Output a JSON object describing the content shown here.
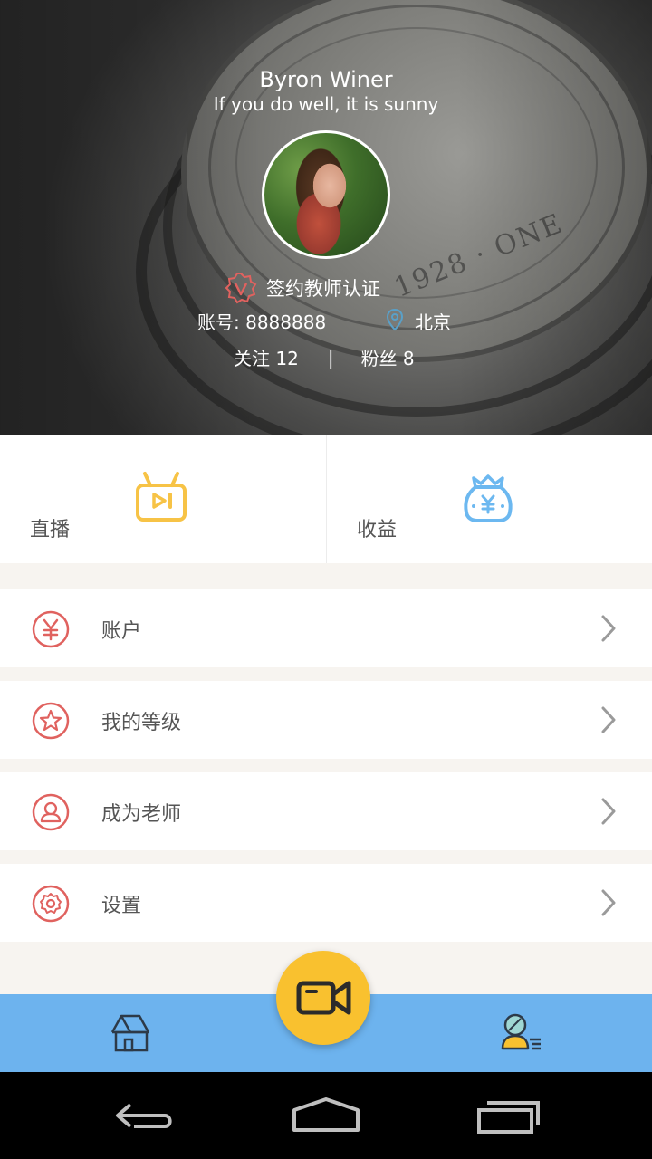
{
  "profile": {
    "name": "Byron Winer",
    "motto": "If you do well, it is sunny",
    "certification": "签约教师认证",
    "account": "账号: 8888888",
    "location": "北京",
    "following": "关注 12",
    "separator": "|",
    "followers": "粉丝 8"
  },
  "tiles": [
    {
      "label": "直播",
      "icon": "tv-play-icon",
      "color": "#f7c346"
    },
    {
      "label": "收益",
      "icon": "money-bag-icon",
      "color": "#6cb8f0"
    }
  ],
  "menu": [
    {
      "label": "账户",
      "icon": "yuan-icon"
    },
    {
      "label": "我的等级",
      "icon": "star-icon"
    },
    {
      "label": "成为老师",
      "icon": "person-icon"
    },
    {
      "label": "设置",
      "icon": "gear-icon"
    }
  ],
  "nav": {
    "home_icon": "home-icon",
    "record_icon": "video-camera-icon",
    "profile_icon": "profile-icon"
  },
  "system": {
    "back_icon": "back-icon",
    "home_icon": "system-home-icon",
    "recents_icon": "recents-icon"
  },
  "colors": {
    "accent_red": "#e0625f",
    "nav_blue": "#6db3ee",
    "fab_yellow": "#f9c12f"
  }
}
